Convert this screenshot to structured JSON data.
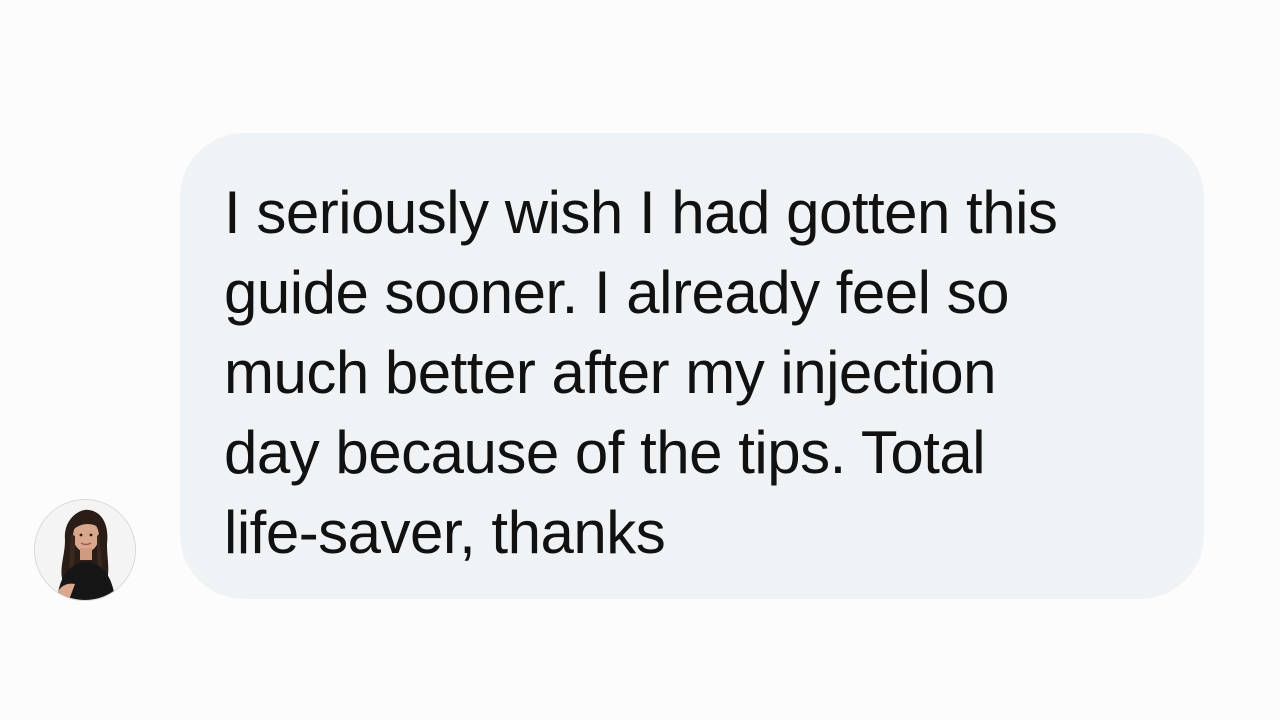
{
  "conversation": {
    "messages": [
      {
        "avatar_icon": "profile-photo",
        "text": "I seriously wish I had gotten this\nguide sooner. I already feel so\nmuch better after my injection\nday because of the tips. Total\nlife-saver, thanks"
      }
    ]
  },
  "colors": {
    "page_background": "#fcfcfc",
    "bubble_background": "#f0f3f5",
    "text": "#111111"
  }
}
